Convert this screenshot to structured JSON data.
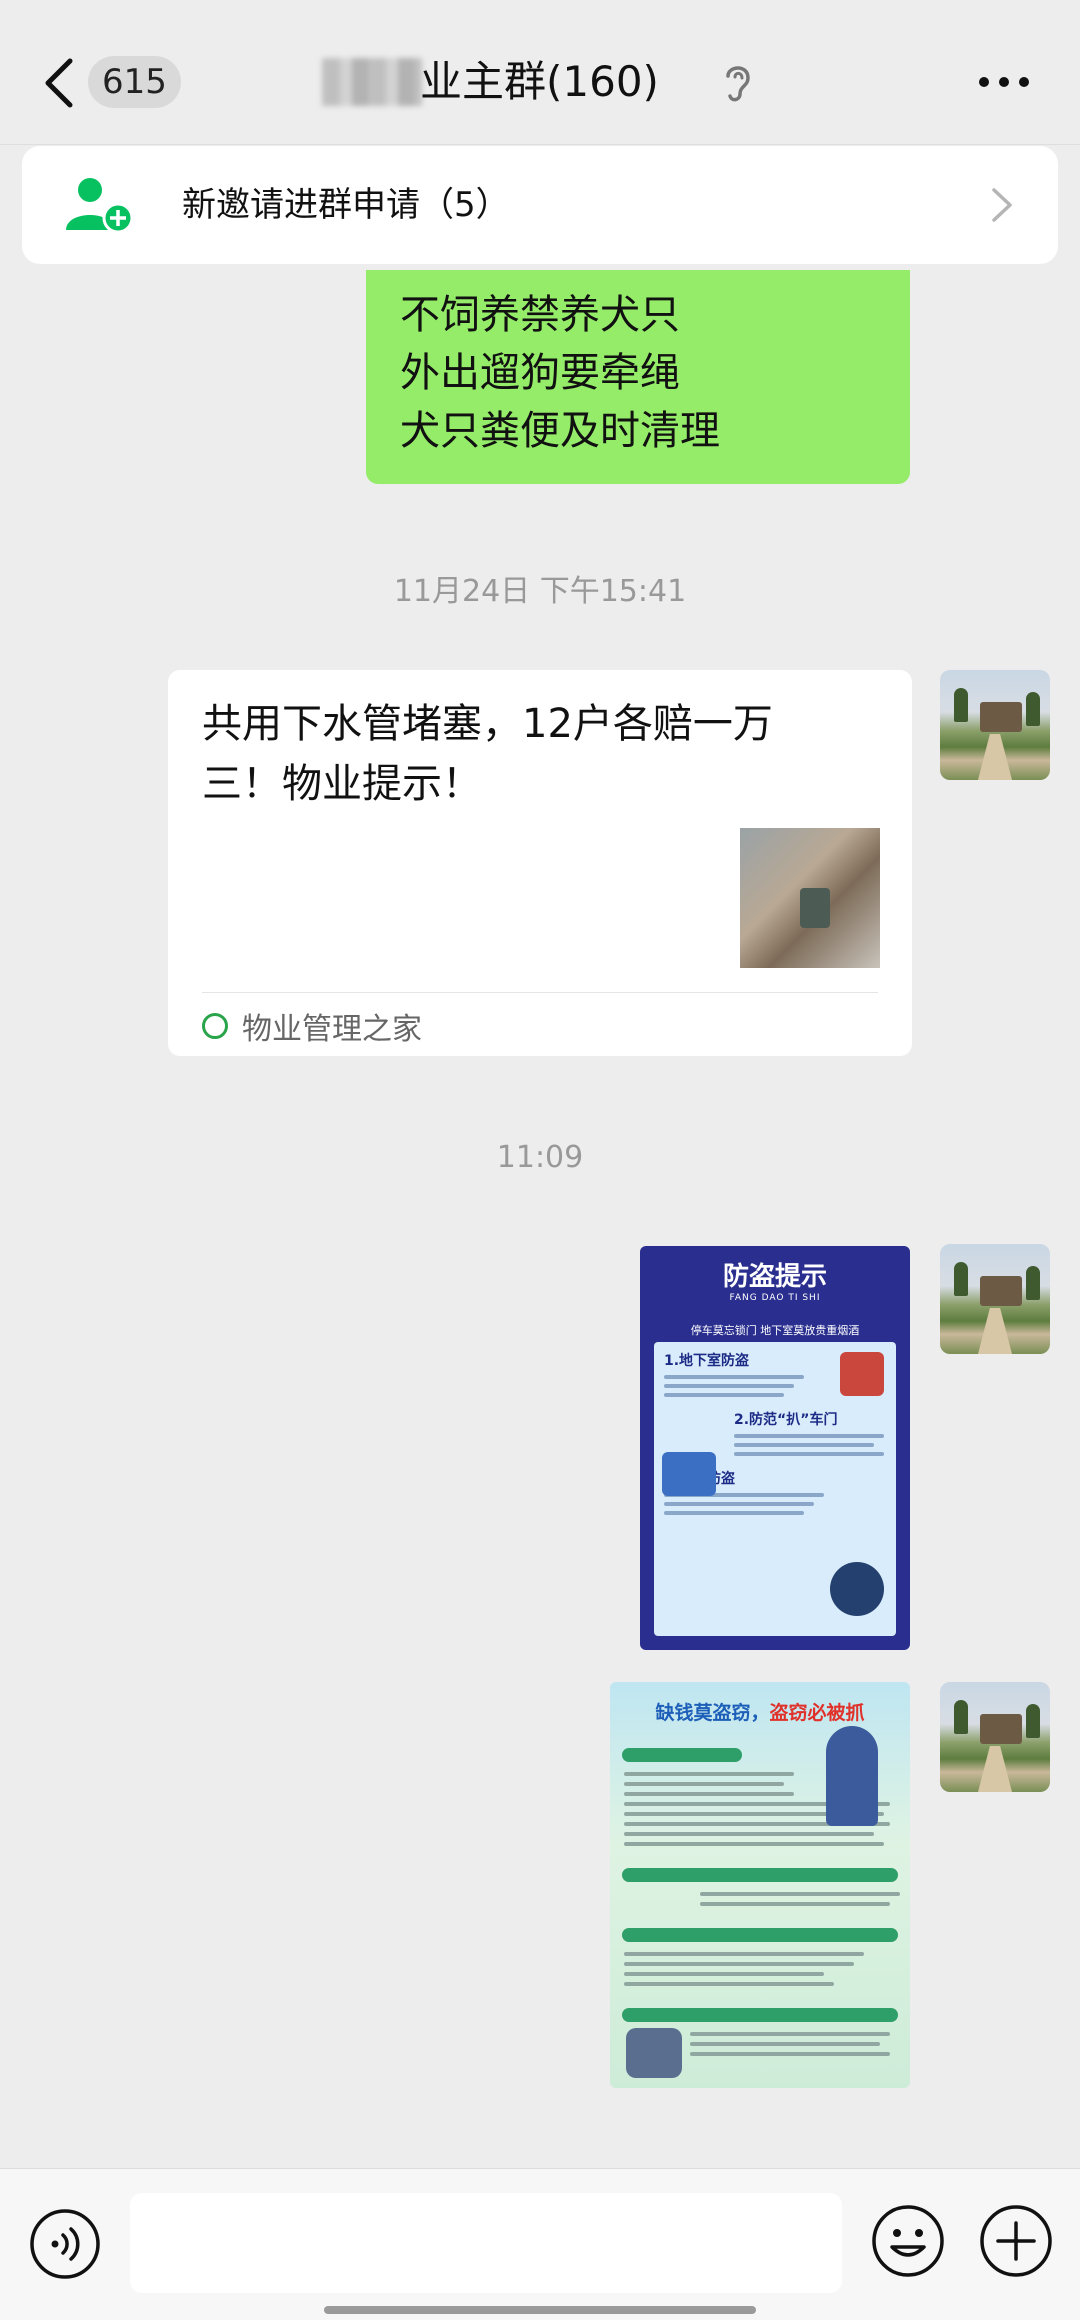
{
  "header": {
    "unread_count": "615",
    "title": "业主群(160)",
    "icons": {
      "back": "chevron-left-icon",
      "mute": "ear-icon",
      "more": "more-icon"
    }
  },
  "notice": {
    "text": "新邀请进群申请（5）",
    "icon": "add-member-icon"
  },
  "messages": {
    "green_lines": [
      "不饲养禁养犬只",
      "外出遛狗要牵绳",
      "犬只粪便及时清理"
    ],
    "timestamp1": "11月24日 下午15:41",
    "link": {
      "title": "共用下水管堵塞，12户各赔一万三！物业提示！",
      "source": "物业管理之家"
    },
    "timestamp2": "11:09",
    "poster1": {
      "title": "防盗提示",
      "pinyin": "FANG DAO TI SHI",
      "subtitle": "停车莫忘锁门 地下室莫放贵重烟酒",
      "sections": [
        "1.地下室防盗",
        "2.防范“扒”车门",
        "3.商铺防盗"
      ]
    },
    "poster2": {
      "title_blue": "缺钱莫盗窃，",
      "title_red": "盗窃必被抓"
    }
  },
  "input": {
    "placeholder": "",
    "icons": {
      "voice": "voice-icon",
      "emoji": "emoji-icon",
      "plus": "plus-icon"
    }
  },
  "colors": {
    "accent_green": "#95ec69",
    "wechat_green": "#07c160",
    "background": "#ededed"
  }
}
